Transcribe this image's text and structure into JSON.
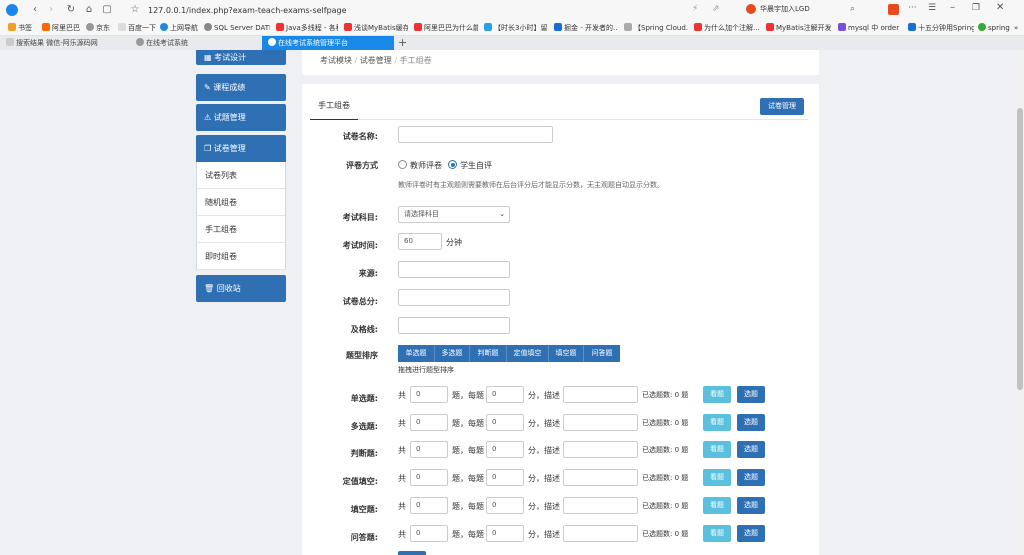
{
  "browser": {
    "url": "127.0.0.1/index.php?exam-teach-exams-selfpage",
    "profile": "华晨宇加入LGD",
    "bookmarks": [
      "书签",
      "阿里巴巴",
      "京东",
      "百度一下",
      "上网导航",
      "SQL Server DATE",
      "Java多线程 - 各种...",
      "浅谈MyBatis缓存...",
      "阿里巴巴为什么能...",
      "【时长3小时】留下...",
      "掘金 - 开发者的...",
      "【Spring Cloud...",
      "为什么加个注解...",
      "MyBatis注解开发...",
      "mysql 中 order by...",
      "十五分钟用Spring...",
      "spring"
    ],
    "tabs": [
      "搜索结果 微信-阿乐源码网",
      "在线考试系统",
      "在线考试系统管理平台"
    ]
  },
  "sidebar": {
    "items": [
      "考试设计",
      "课程成绩",
      "试题管理",
      "试卷管理"
    ],
    "sub_items": [
      "试卷列表",
      "随机组卷",
      "手工组卷",
      "即时组卷"
    ],
    "recycle": "回收站"
  },
  "breadcrumb": [
    "考试模块",
    "试卷管理",
    "手工组卷"
  ],
  "panel_title": "手工组卷",
  "manage_button": "试卷管理",
  "form": {
    "name_label": "试卷名称:",
    "mode_label": "评卷方式",
    "mode_teacher": "教师评卷",
    "mode_student": "学生自评",
    "mode_hint": "教师评卷时有主观题则需要教师在后台评分后才能显示分数，无主观题自动显示分数。",
    "subject_label": "考试科目:",
    "subject_placeholder": "请选择科目",
    "time_label": "考试时间:",
    "time_value": "60",
    "time_unit": "分钟",
    "source_label": "来源:",
    "total_label": "试卷总分:",
    "pass_label": "及格线:",
    "order_label": "题型排序",
    "order_hint": "拖拽进行题型排序"
  },
  "question_types": [
    "单选题",
    "多选题",
    "判断题",
    "定值填空",
    "填空题",
    "问答题"
  ],
  "question_rows": [
    {
      "label": "单选题:",
      "count": "0",
      "score": "0",
      "selected": "0"
    },
    {
      "label": "多选题:",
      "count": "0",
      "score": "0",
      "selected": "0"
    },
    {
      "label": "判断题:",
      "count": "0",
      "score": "0",
      "selected": "0"
    },
    {
      "label": "定值填空:",
      "count": "0",
      "score": "0",
      "selected": "0"
    },
    {
      "label": "填空题:",
      "count": "0",
      "score": "0",
      "selected": "0"
    },
    {
      "label": "问答题:",
      "count": "0",
      "score": "0",
      "selected": "0"
    }
  ],
  "row_text": {
    "total": "共",
    "per": "题，每题",
    "points": "分，描述",
    "selected_prefix": "已选题数:",
    "selected_suffix": "题",
    "view": "看题",
    "pick": "选题"
  }
}
